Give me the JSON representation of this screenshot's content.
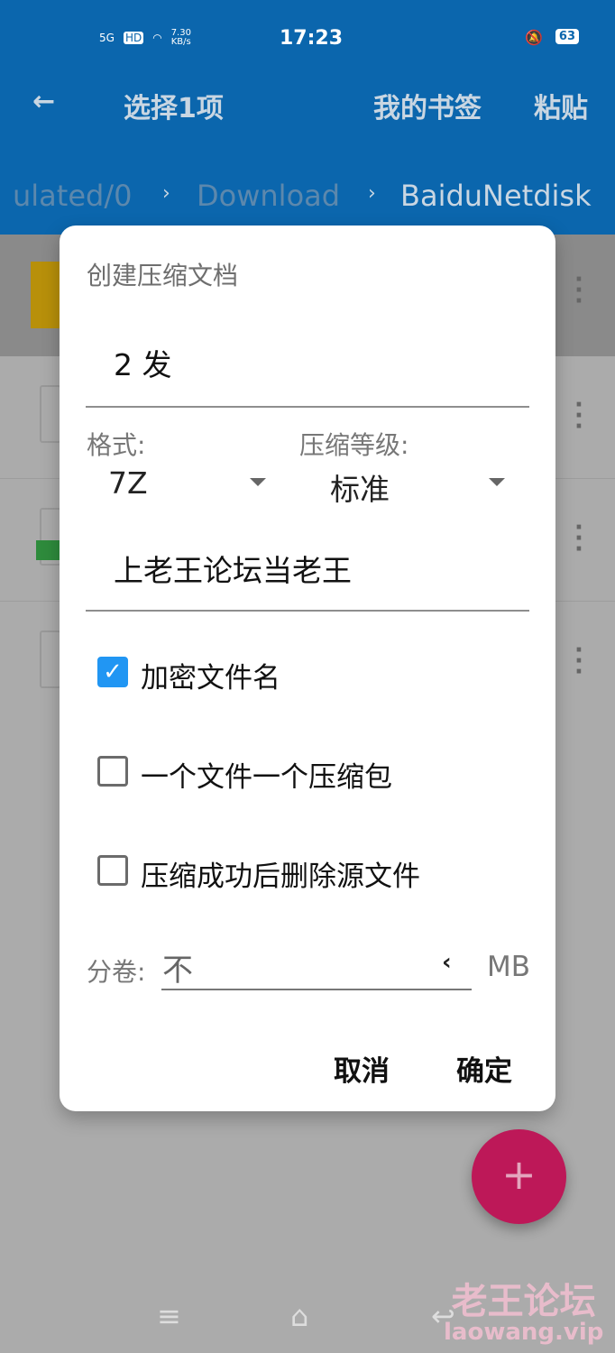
{
  "status_bar": {
    "network": "5G",
    "hd": "HD",
    "speed": "7.30 KB/s",
    "time": "17:23",
    "battery": "63"
  },
  "app_bar": {
    "title": "选择1项",
    "bookmarks": "我的书签",
    "paste": "粘贴"
  },
  "breadcrumb": [
    "ulated/0",
    "Download",
    "BaiduNetdisk"
  ],
  "dialog": {
    "title": "创建压缩文档",
    "filename": "2 发",
    "format_label": "格式:",
    "format_value": "7Z",
    "level_label": "压缩等级:",
    "level_value": "标准",
    "password": "上老王论坛当老王",
    "options": [
      {
        "label": "加密文件名",
        "checked": true
      },
      {
        "label": "一个文件一个压缩包",
        "checked": false
      },
      {
        "label": "压缩成功后删除源文件",
        "checked": false
      }
    ],
    "split_label": "分卷:",
    "split_value": "不",
    "split_unit": "MB",
    "cancel": "取消",
    "ok": "确定"
  },
  "fab": "+",
  "watermark": {
    "line1": "老王论坛",
    "line2": "laowang.vip"
  },
  "colors": {
    "app_bar": "#0b66ad",
    "accent": "#2196f3",
    "fab": "#bd1858"
  }
}
